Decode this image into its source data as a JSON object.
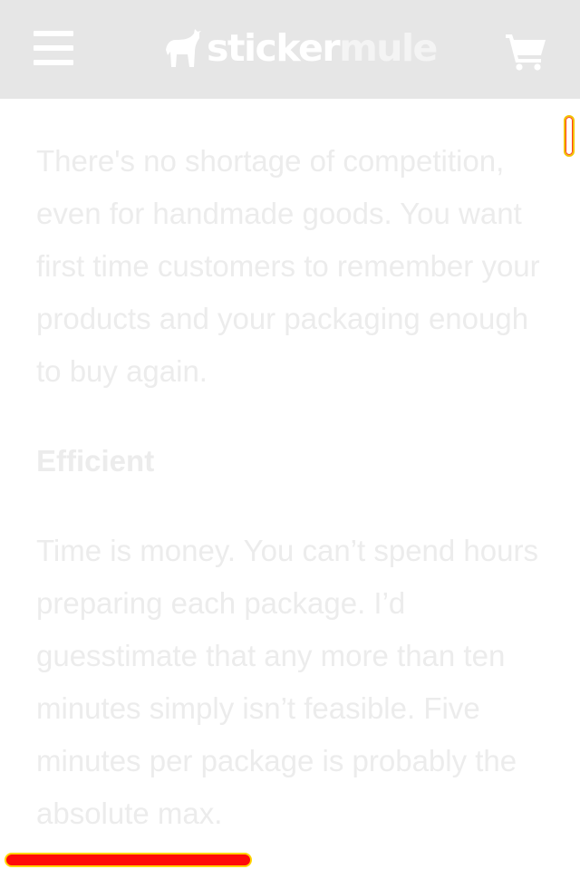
{
  "header": {
    "menu_icon": "hamburger-menu-icon",
    "logo": {
      "part1": "sticker",
      "part2": "mule",
      "mark_icon": "mule-silhouette-icon"
    },
    "cart_icon": "shopping-cart-icon"
  },
  "article": {
    "paragraph1": "There's no shortage of competition, even for handmade goods. You want first time customers to remember your products and your packaging enough to buy again.",
    "heading": "Efficient",
    "paragraph2": "Time is money. You can’t spend hours preparing each package. I’d guesstimate that any more than ten minutes simply isn’t feasible. Five minutes per package is probably the absolute max."
  },
  "colors": {
    "header_bg": "#e6e6e6",
    "text": "#ececec",
    "highlight_red": "#ff0a0a",
    "highlight_yellow": "#ffd400"
  }
}
